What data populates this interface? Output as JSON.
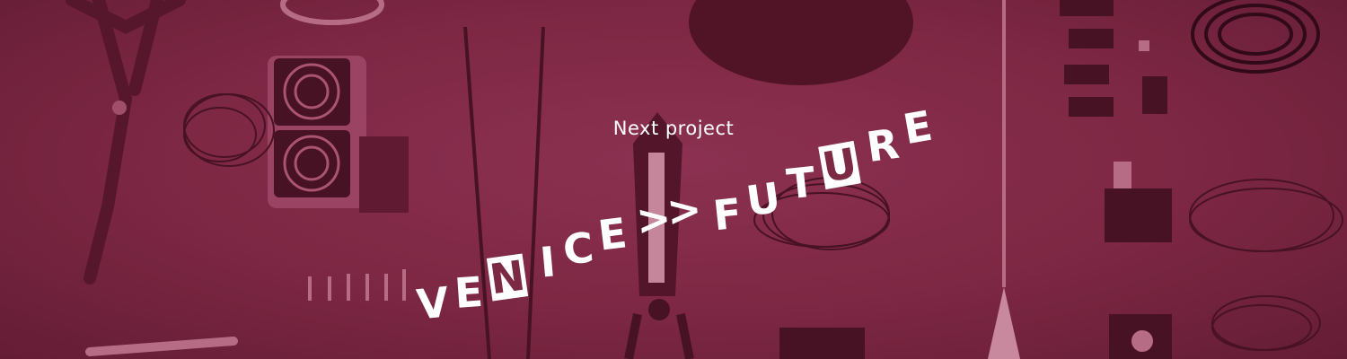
{
  "banner": {
    "eyebrow": "Next project",
    "title_letters": [
      "V",
      "E",
      "N",
      "I",
      "C",
      "E",
      ">",
      ">",
      "F",
      "U",
      "T",
      "U",
      "R",
      "E"
    ],
    "colors": {
      "overlay": "#7c2944",
      "text": "#ffffff"
    }
  }
}
